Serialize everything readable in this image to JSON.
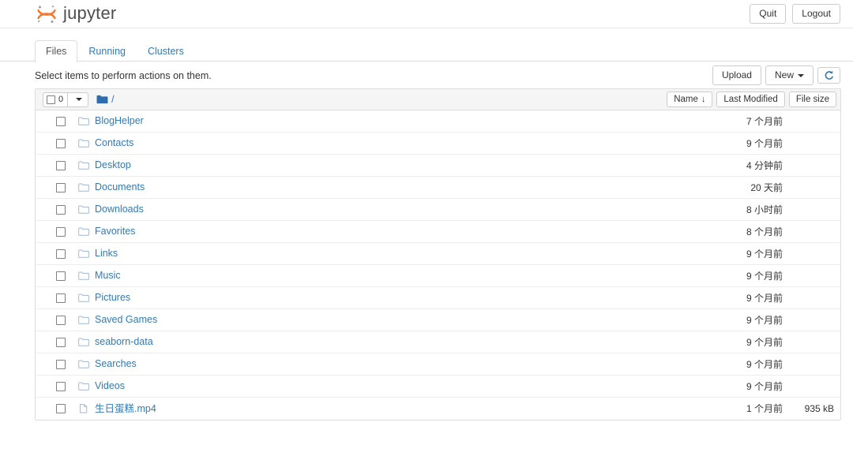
{
  "header": {
    "brand": "jupyter",
    "logo_icon": "jupyter-logo",
    "quit_label": "Quit",
    "logout_label": "Logout"
  },
  "tabs": [
    {
      "label": "Files",
      "active": true
    },
    {
      "label": "Running",
      "active": false
    },
    {
      "label": "Clusters",
      "active": false
    }
  ],
  "actions": {
    "select_hint": "Select items to perform actions on them.",
    "upload_label": "Upload",
    "new_label": "New",
    "new_caret_icon": "chevron-down-icon",
    "refresh_icon": "refresh-icon"
  },
  "list_toolbar": {
    "select_all_icon": "checkbox-icon",
    "selected_count": "0",
    "select_caret_icon": "chevron-down-icon",
    "breadcrumb_icon": "folder-filled-icon",
    "breadcrumb_path": "/",
    "sort_name": "Name",
    "sort_name_arrow": "↓",
    "sort_modified": "Last Modified",
    "sort_size": "File size"
  },
  "files": [
    {
      "name": "BlogHelper",
      "type": "folder",
      "icon": "folder-icon",
      "modified": "7 个月前",
      "size": ""
    },
    {
      "name": "Contacts",
      "type": "folder",
      "icon": "folder-icon",
      "modified": "9 个月前",
      "size": ""
    },
    {
      "name": "Desktop",
      "type": "folder",
      "icon": "folder-icon",
      "modified": "4 分钟前",
      "size": ""
    },
    {
      "name": "Documents",
      "type": "folder",
      "icon": "folder-icon",
      "modified": "20 天前",
      "size": ""
    },
    {
      "name": "Downloads",
      "type": "folder",
      "icon": "folder-icon",
      "modified": "8 小时前",
      "size": ""
    },
    {
      "name": "Favorites",
      "type": "folder",
      "icon": "folder-icon",
      "modified": "8 个月前",
      "size": ""
    },
    {
      "name": "Links",
      "type": "folder",
      "icon": "folder-icon",
      "modified": "9 个月前",
      "size": ""
    },
    {
      "name": "Music",
      "type": "folder",
      "icon": "folder-icon",
      "modified": "9 个月前",
      "size": ""
    },
    {
      "name": "Pictures",
      "type": "folder",
      "icon": "folder-icon",
      "modified": "9 个月前",
      "size": ""
    },
    {
      "name": "Saved Games",
      "type": "folder",
      "icon": "folder-icon",
      "modified": "9 个月前",
      "size": ""
    },
    {
      "name": "seaborn-data",
      "type": "folder",
      "icon": "folder-icon",
      "modified": "9 个月前",
      "size": ""
    },
    {
      "name": "Searches",
      "type": "folder",
      "icon": "folder-icon",
      "modified": "9 个月前",
      "size": ""
    },
    {
      "name": "Videos",
      "type": "folder",
      "icon": "folder-icon",
      "modified": "9 个月前",
      "size": ""
    },
    {
      "name": "生日蛋糕.mp4",
      "type": "file",
      "icon": "file-icon",
      "modified": "1 个月前",
      "size": "935 kB"
    }
  ],
  "colors": {
    "link": "#337ab7",
    "logo_orange": "#f37726",
    "logo_gray": "#9e9e9e",
    "toolbar_bg": "#f5f5f5",
    "border": "#dddddd",
    "folder_outline": "#a3b8d4",
    "folder_filled": "#2f6bb0"
  }
}
